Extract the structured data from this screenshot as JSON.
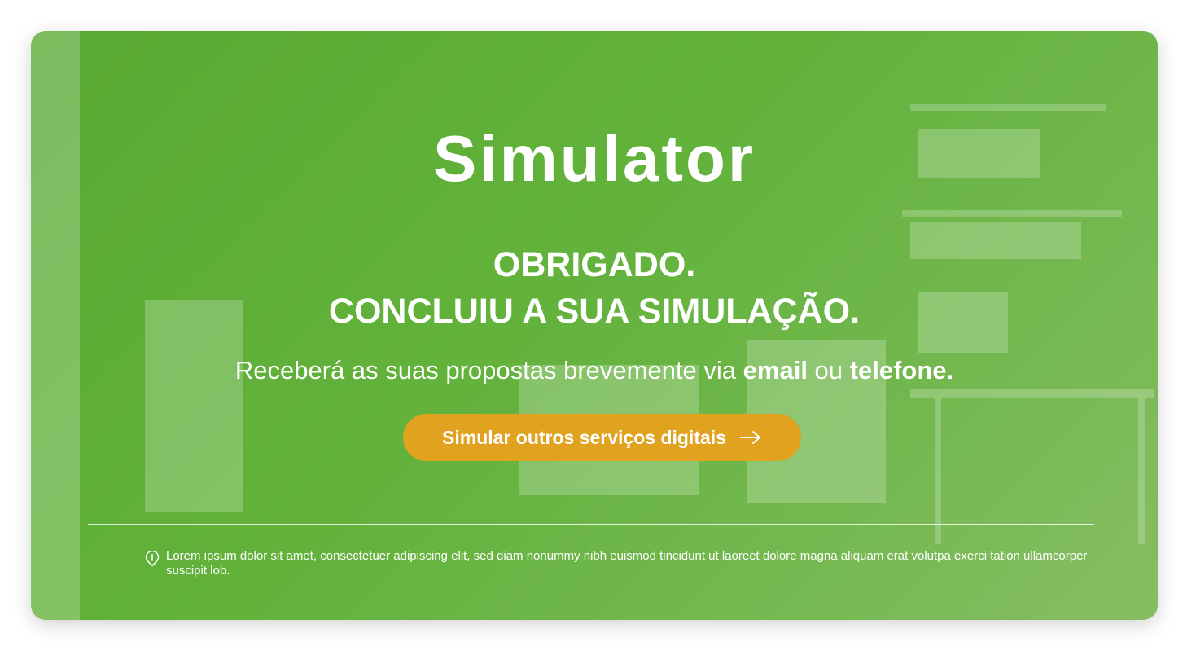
{
  "page": {
    "title": "Simulator",
    "heading_line1": "OBRIGADO.",
    "heading_line2": "CONCLUIU A SUA SIMULAÇÃO.",
    "subtitle_prefix": "Receberá as suas propostas brevemente via ",
    "subtitle_email": "email",
    "subtitle_middle": " ou ",
    "subtitle_phone": "telefone."
  },
  "cta": {
    "label": "Simular outros serviços digitais",
    "icon": "arrow-right-icon"
  },
  "footer": {
    "icon": "info-icon",
    "disclaimer": "Lorem ipsum dolor sit amet, consectetuer adipiscing elit, sed diam nonummy nibh euismod tincidunt ut laoreet dolore magna aliquam erat volutpa exerci tation ullamcorper suscipit lob."
  },
  "colors": {
    "primary_green": "#5aab34",
    "button_orange": "#e0a21f",
    "text": "#ffffff"
  }
}
